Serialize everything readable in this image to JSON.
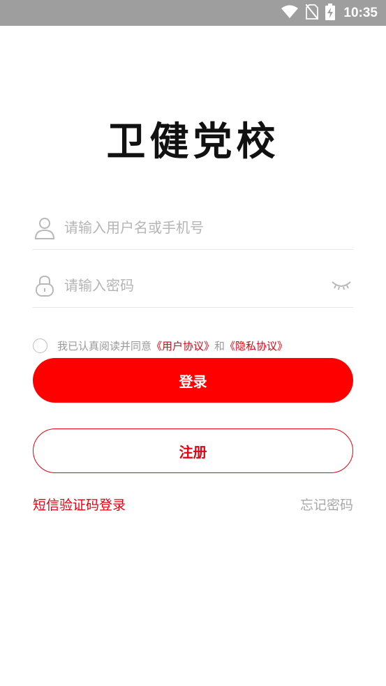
{
  "status_bar": {
    "time": "10:35",
    "icons": [
      "wifi-icon",
      "no-sim-icon",
      "battery-charging-icon"
    ]
  },
  "app": {
    "logo_text": "卫健党校"
  },
  "login_form": {
    "username_placeholder": "请输入用户名或手机号",
    "username_value": "",
    "password_placeholder": "请输入密码",
    "password_value": "",
    "icons": {
      "username": "user-icon",
      "password": "lock-icon",
      "visibility": "eye-closed-icon"
    }
  },
  "agreement": {
    "prefix": "我已认真阅读并同意",
    "user_agreement": "《用户协议》",
    "conjunction": "和",
    "privacy_policy": "《隐私协议》",
    "checked": false
  },
  "buttons": {
    "login": "登录",
    "register": "注册"
  },
  "links": {
    "sms_login": "短信验证码登录",
    "forgot_password": "忘记密码"
  },
  "colors": {
    "brand_red": "#ff0000",
    "link_red": "#e60012",
    "placeholder_gray": "#b5b5b5",
    "status_bar_bg": "#9e9e9e"
  }
}
